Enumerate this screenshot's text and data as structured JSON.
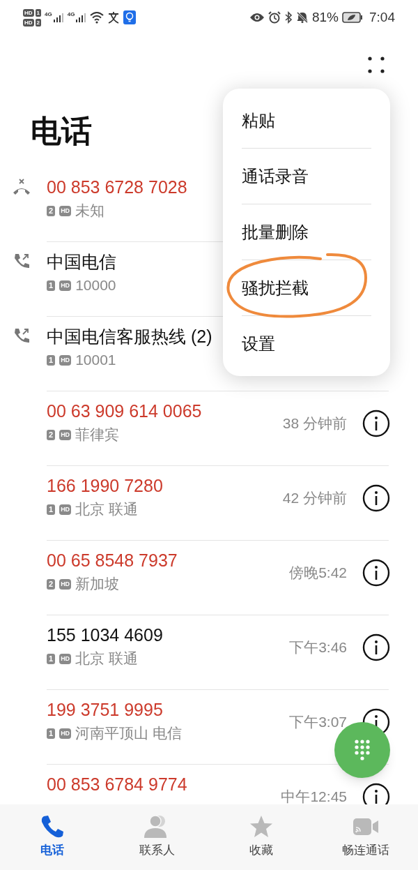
{
  "status_bar": {
    "sim_badges": [
      {
        "hd": "HD",
        "sim": "1"
      },
      {
        "hd": "HD",
        "sim": "2"
      }
    ],
    "networks": [
      "4G",
      "4G"
    ],
    "battery": "81%",
    "time": "7:04"
  },
  "title": "电话",
  "calls": [
    {
      "title": "00 853 6728 7028",
      "missed": true,
      "kind": "missed",
      "sim": "2",
      "hd": "HD",
      "detail": "未知"
    },
    {
      "title": "中国电信",
      "missed": false,
      "kind": "outgoing",
      "sim": "1",
      "hd": "HD",
      "detail": "10000"
    },
    {
      "title": "中国电信客服热线 (2)",
      "missed": false,
      "kind": "outgoing",
      "sim": "1",
      "hd": "HD",
      "detail": "10001"
    },
    {
      "title": "00 63 909 614 0065",
      "missed": true,
      "sim": "2",
      "hd": "HD",
      "detail": "菲律宾",
      "time": "38 分钟前"
    },
    {
      "title": "166 1990 7280",
      "missed": true,
      "sim": "1",
      "hd": "HD",
      "detail": "北京 联通",
      "time": "42 分钟前"
    },
    {
      "title": "00 65 8548 7937",
      "missed": true,
      "sim": "2",
      "hd": "HD",
      "detail": "新加坡",
      "time": "傍晚5:42"
    },
    {
      "title": "155 1034 4609",
      "missed": false,
      "sim": "1",
      "hd": "HD",
      "detail": "北京 联通",
      "time": "下午3:46"
    },
    {
      "title": "199 3751 9995",
      "missed": true,
      "sim": "1",
      "hd": "HD",
      "detail": "河南平顶山 电信",
      "time": "下午3:07"
    },
    {
      "title": "00 853 6784 9774",
      "missed": true,
      "time": "中午12:45"
    }
  ],
  "menu": {
    "items": [
      {
        "label": "粘贴",
        "circled": false
      },
      {
        "label": "通话录音",
        "circled": false
      },
      {
        "label": "批量删除",
        "circled": false
      },
      {
        "label": "骚扰拦截",
        "circled": true
      },
      {
        "label": "设置",
        "circled": false
      }
    ]
  },
  "tabs": [
    {
      "label": "电话",
      "kind": "phone",
      "selected": true
    },
    {
      "label": "联系人",
      "kind": "contacts",
      "selected": false
    },
    {
      "label": "收藏",
      "kind": "star",
      "selected": false
    },
    {
      "label": "畅连通话",
      "kind": "video",
      "selected": false
    }
  ]
}
